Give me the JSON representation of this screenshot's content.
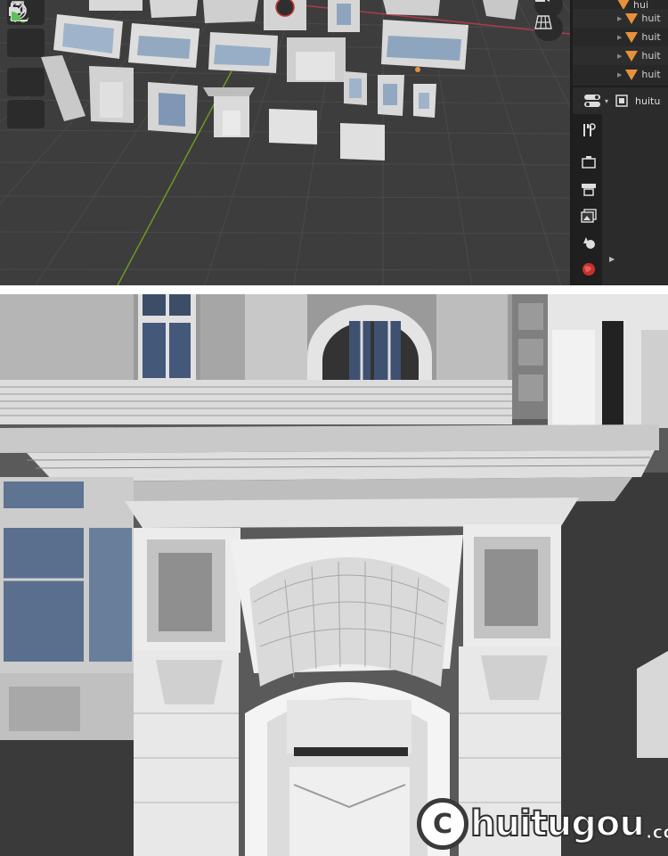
{
  "outliner": {
    "items": [
      {
        "label": "hui"
      },
      {
        "label": "huit"
      },
      {
        "label": "huit"
      },
      {
        "label": "huit"
      },
      {
        "label": "huit"
      }
    ]
  },
  "properties": {
    "object_name": "huitu"
  },
  "watermark": {
    "logo_letter": "C",
    "brand": "huitugou",
    "suffix": ".com"
  },
  "colors": {
    "viewport_bg": "#3d3d3d",
    "grid_line": "#4a4a4a",
    "x_axis": "#b03a48",
    "y_axis": "#6a9a22",
    "mesh_icon": "#e8913a",
    "toolbar_bg": "#2b2b2b",
    "window_glass": "#4d6585"
  },
  "icons": {
    "toolbar": [
      "move-icon",
      "transform-icon",
      "annotate-icon",
      "measure-icon"
    ],
    "viewport": [
      "camera-icon",
      "grid-view-icon"
    ],
    "property_tabs": [
      "tool-icon",
      "render-icon",
      "output-icon",
      "view-layer-icon",
      "scene-icon",
      "world-icon"
    ]
  }
}
